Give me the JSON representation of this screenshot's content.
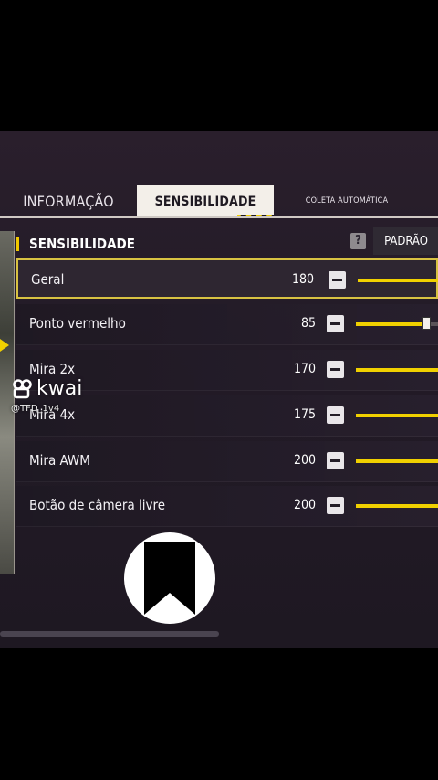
{
  "tabs": [
    {
      "label": "INFORMAÇÃO"
    },
    {
      "label": "SENSIBILIDADE"
    },
    {
      "label": "COLETA AUTOMÁTICA"
    }
  ],
  "section": {
    "title": "SENSIBILIDADE",
    "help_label": "?",
    "default_button": "PADRÃO"
  },
  "rows": [
    {
      "label": "Geral",
      "value": "180",
      "level": 1.0
    },
    {
      "label": "Ponto vermelho",
      "value": "85",
      "level": 0.85
    },
    {
      "label": "Mira 2x",
      "value": "170",
      "level": 1.0
    },
    {
      "label": "Mira 4x",
      "value": "175",
      "level": 1.0
    },
    {
      "label": "Mira AWM",
      "value": "200",
      "level": 1.0
    },
    {
      "label": "Botão de câmera livre",
      "value": "200",
      "level": 1.0
    }
  ],
  "watermark": {
    "brand": "kwai",
    "handle": "@TFD_1v4"
  },
  "colors": {
    "accent": "#f0d000",
    "panel": "#231b27"
  }
}
